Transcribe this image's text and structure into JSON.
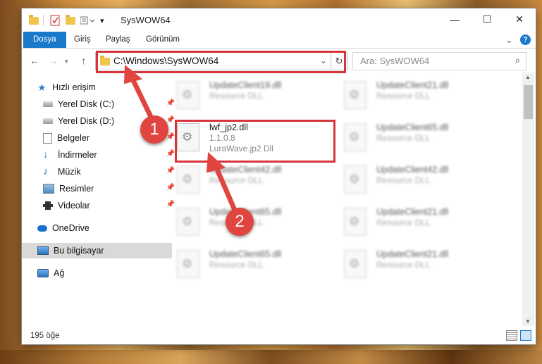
{
  "window": {
    "title": "SysWOW64",
    "controls": {
      "minimize": "—",
      "maximize": "☐",
      "close": "✕"
    }
  },
  "ribbon": {
    "tabs": [
      "Dosya",
      "Giriş",
      "Paylaş",
      "Görünüm"
    ],
    "expand": "⌄",
    "help": "?"
  },
  "address": {
    "path": "C:\\Windows\\SysWOW64",
    "search_placeholder": "Ara: SysWOW64"
  },
  "sidebar": {
    "items": [
      {
        "label": "Hızlı erişim",
        "icon": "star-icon",
        "pinned": false
      },
      {
        "label": "Yerel Disk (C:)",
        "icon": "drive-icon",
        "pinned": true
      },
      {
        "label": "Yerel Disk (D:)",
        "icon": "drive-icon",
        "pinned": true
      },
      {
        "label": "Belgeler",
        "icon": "documents-icon",
        "pinned": true
      },
      {
        "label": "İndirmeler",
        "icon": "download-icon",
        "pinned": true
      },
      {
        "label": "Müzik",
        "icon": "music-icon",
        "pinned": true
      },
      {
        "label": "Resimler",
        "icon": "pictures-icon",
        "pinned": true
      },
      {
        "label": "Videolar",
        "icon": "videos-icon",
        "pinned": true
      },
      {
        "label": "OneDrive",
        "icon": "cloud-icon",
        "pinned": false
      },
      {
        "label": "Bu bilgisayar",
        "icon": "computer-icon",
        "pinned": false
      },
      {
        "label": "Ağ",
        "icon": "network-icon",
        "pinned": false
      }
    ]
  },
  "files": {
    "highlighted": {
      "name": "lwf_jp2.dll",
      "version": "1.1.0.8",
      "description": "LuraWave.jp2 Dll"
    },
    "blurred": [
      {
        "name": "UpdateClient19.dll",
        "desc": "Resource DLL"
      },
      {
        "name": "UpdateClient21.dll",
        "desc": "Resource DLL"
      },
      {
        "name": "UpdateClient65.dll",
        "desc": "Resource DLL"
      },
      {
        "name": "UpdateClient42.dll",
        "desc": "Resource DLL"
      },
      {
        "name": "UpdateClient42.dll",
        "desc": "Resource DLL"
      },
      {
        "name": "UpdateClient65.dll",
        "desc": "Resource DLL"
      },
      {
        "name": "UpdateClient21.dll",
        "desc": "Resource DLL"
      },
      {
        "name": "UpdateClient65.dll",
        "desc": "Resource DLL"
      },
      {
        "name": "UpdateClient21.dll",
        "desc": "Resource DLL"
      }
    ]
  },
  "status": {
    "item_count": "195 öğe"
  },
  "callouts": [
    "1",
    "2"
  ],
  "colors": {
    "accent": "#1979ca",
    "highlight": "#d9343a",
    "callout": "#e0453f",
    "folder": "#f0c64a"
  }
}
